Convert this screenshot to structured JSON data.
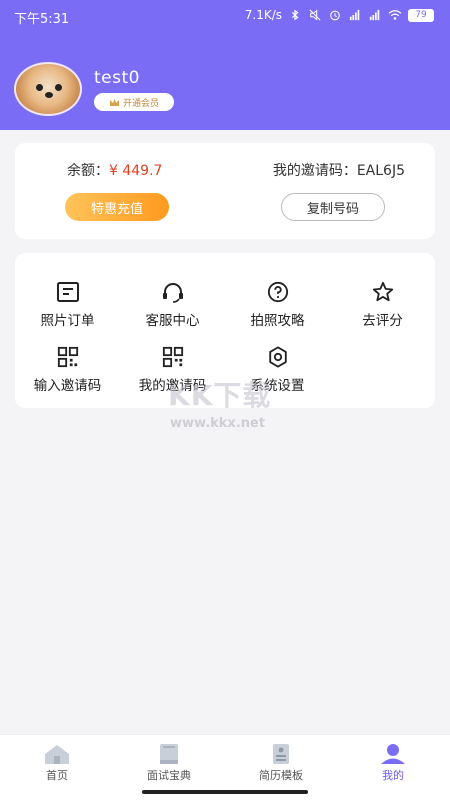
{
  "status_bar": {
    "time": "下午5:31",
    "speed": "7.1K/s",
    "battery": "79"
  },
  "profile": {
    "username": "test0",
    "vip_badge": "开通会员"
  },
  "account": {
    "balance_label": "余额：",
    "balance_value": "¥ 449.7",
    "invite_label": "我的邀请码：",
    "invite_code": "EAL6J5",
    "recharge_button": "特惠充值",
    "copy_button": "复制号码"
  },
  "menu": [
    {
      "label": "照片订单",
      "icon": "photo-order-icon"
    },
    {
      "label": "客服中心",
      "icon": "headset-icon"
    },
    {
      "label": "拍照攻略",
      "icon": "question-icon"
    },
    {
      "label": "去评分",
      "icon": "star-icon"
    },
    {
      "label": "输入邀请码",
      "icon": "qrcode-icon"
    },
    {
      "label": "我的邀请码",
      "icon": "my-qrcode-icon"
    },
    {
      "label": "系统设置",
      "icon": "gear-icon"
    }
  ],
  "watermark": {
    "text": "KK下载",
    "url": "www.kkx.net"
  },
  "tabbar": [
    {
      "label": "首页",
      "icon": "home-icon"
    },
    {
      "label": "面试宝典",
      "icon": "book-icon"
    },
    {
      "label": "简历模板",
      "icon": "resume-icon"
    },
    {
      "label": "我的",
      "icon": "user-icon",
      "active": true
    }
  ],
  "colors": {
    "header": "#7b6cf6",
    "accent": "#6d5bf0",
    "price": "#e0401f",
    "recharge_gradient": [
      "#ffc35a",
      "#ff9a1f"
    ]
  }
}
